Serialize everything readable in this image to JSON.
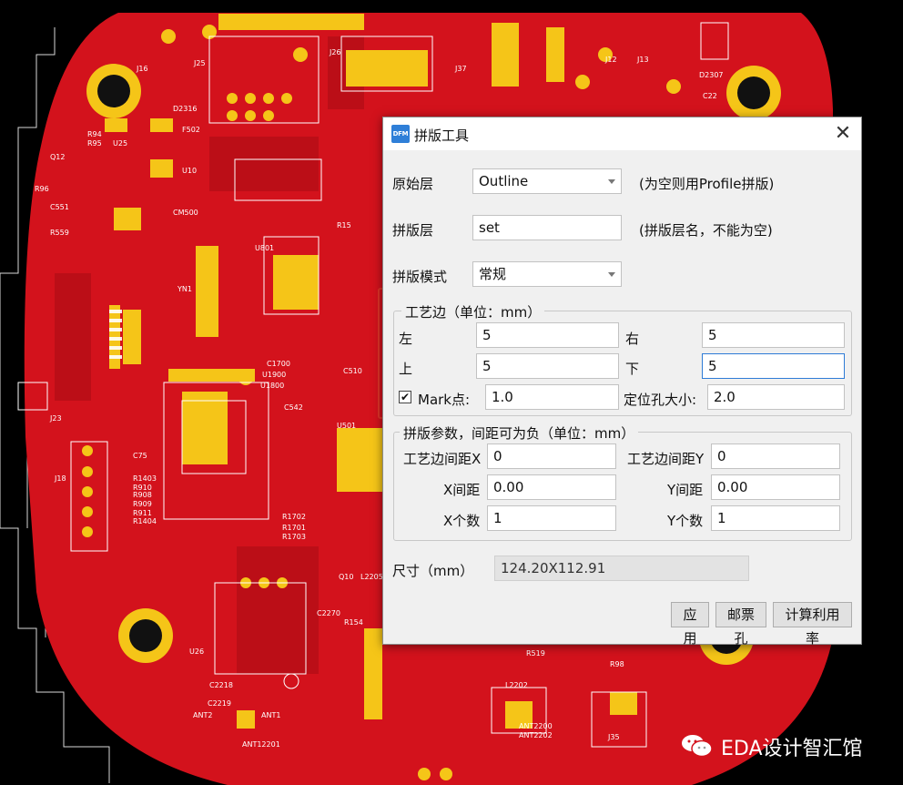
{
  "dialog": {
    "title": "拼版工具",
    "app_icon_text": "DFM",
    "close_glyph": "✕",
    "orig_layer": {
      "label": "原始层",
      "value": "Outline",
      "hint": "(为空则用Profile拼版)"
    },
    "panel_layer": {
      "label": "拼版层",
      "value": "set",
      "hint": "(拼版层名，不能为空)"
    },
    "panel_mode": {
      "label": "拼版模式",
      "value": "常规"
    },
    "process_edge": {
      "legend": "工艺边（单位：mm）",
      "left_label": "左",
      "left_value": "5",
      "right_label": "右",
      "right_value": "5",
      "top_label": "上",
      "top_value": "5",
      "bottom_label": "下",
      "bottom_value": "5",
      "mark_label": "Mark点:",
      "mark_checked": true,
      "mark_value": "1.0",
      "hole_label": "定位孔大小:",
      "hole_value": "2.0"
    },
    "panel_params": {
      "legend": "拼版参数，间距可为负（单位：mm）",
      "edge_gap_x_label": "工艺边间距X",
      "edge_gap_x_value": "0",
      "edge_gap_y_label": "工艺边间距Y",
      "edge_gap_y_value": "0",
      "x_gap_label": "X间距",
      "x_gap_value": "0.00",
      "y_gap_label": "Y间距",
      "y_gap_value": "0.00",
      "x_count_label": "X个数",
      "x_count_value": "1",
      "y_count_label": "Y个数",
      "y_count_value": "1"
    },
    "size": {
      "label": "尺寸（mm）",
      "value": "124.20X112.91"
    },
    "buttons": {
      "apply": "应用",
      "stamp_hole": "邮票孔",
      "calc_util": "计算利用率"
    }
  },
  "watermark": {
    "text": "EDA设计智汇馆",
    "icon": "wechat-icon"
  },
  "colors": {
    "board": "#d3121c",
    "pad": "#f5c518",
    "silkscreen": "#ffffff",
    "highlight": "#e03427",
    "focus": "#2e7bd6"
  },
  "pcb_labels": [
    "J16",
    "J25",
    "J26",
    "J37",
    "J12",
    "J13",
    "D2316",
    "F502",
    "R94",
    "R95",
    "U25",
    "U10",
    "Q12",
    "R96",
    "C551",
    "R559",
    "U501",
    "C510",
    "C542",
    "J23",
    "J18",
    "C75",
    "R1403",
    "R910",
    "R908",
    "R909",
    "R911",
    "R1404",
    "R1702",
    "R1701",
    "R1703",
    "U1900",
    "U1800",
    "C1700",
    "U26",
    "C2218",
    "C2219",
    "ANT2",
    "ANT1",
    "L2203",
    "ANT12201",
    "R519",
    "R98",
    "L2202",
    "J35",
    "ANT2200",
    "ANT2202",
    "Q10",
    "R154",
    "C2270",
    "L2205",
    "C22",
    "D2307",
    "CM500",
    "YN1",
    "U1801"
  ]
}
